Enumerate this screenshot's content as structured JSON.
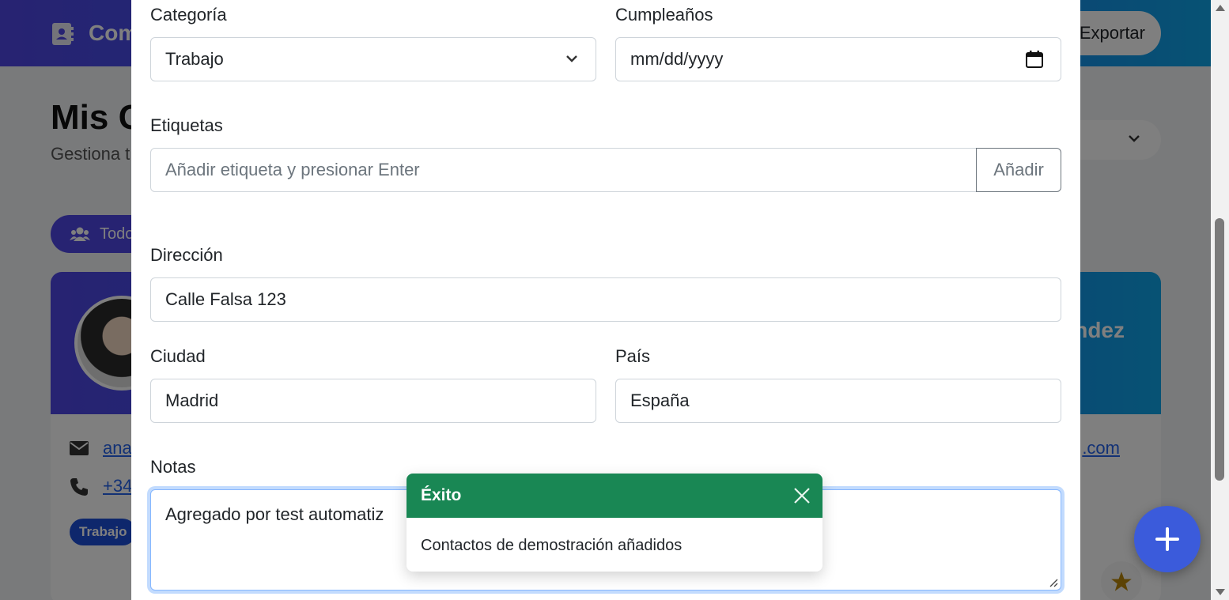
{
  "background": {
    "app_title": "Com",
    "export_label": "Exportar",
    "page_title": "Mis C",
    "page_subtitle": "Gestiona t",
    "filter_label": "Todo",
    "contact_name": "ndez",
    "contact_email": "ana",
    "contact_email_end": ".com",
    "contact_phone": "+34",
    "badge_label": "Trabajo"
  },
  "form": {
    "category_label": "Categoría",
    "category_value": "Trabajo",
    "birthday_label": "Cumpleaños",
    "birthday_placeholder": "mm/dd/yyyy",
    "tags_label": "Etiquetas",
    "tags_placeholder": "Añadir etiqueta y presionar Enter",
    "tags_add_button": "Añadir",
    "address_label": "Dirección",
    "address_value": "Calle Falsa 123",
    "city_label": "Ciudad",
    "city_value": "Madrid",
    "country_label": "País",
    "country_value": "España",
    "notes_label": "Notas",
    "notes_value": "Agregado por test automatiz"
  },
  "toast": {
    "title": "Éxito",
    "message": "Contactos de demostración añadidos",
    "header_color": "#198754"
  },
  "colors": {
    "brand_gradient_start": "#4f46e5",
    "brand_gradient_end": "#0ea5e9",
    "fab": "#3b5bdb"
  },
  "icons": [
    "address-book-icon",
    "users-icon",
    "envelope-icon",
    "phone-icon",
    "star-icon",
    "plus-icon",
    "chevron-down-icon",
    "calendar-icon",
    "close-icon"
  ]
}
